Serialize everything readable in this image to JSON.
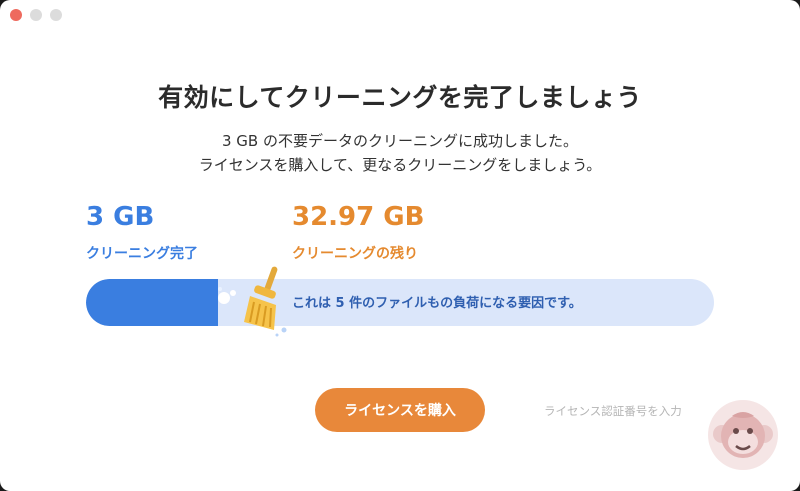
{
  "window": {
    "controls": [
      "close",
      "minimize",
      "maximize"
    ]
  },
  "header": {
    "title": "有効にしてクリーニングを完了しましょう",
    "subtitle_line1": "3 GB の不要データのクリーニングに成功しました。",
    "subtitle_line2": "ライセンスを購入して、更なるクリーニングをしましょう。"
  },
  "stats": {
    "cleaned": {
      "value": "3 GB",
      "label": "クリーニング完了",
      "color": "#3a7ee0"
    },
    "remaining": {
      "value": "32.97 GB",
      "label": "クリーニングの残り",
      "color": "#e58a2f"
    }
  },
  "progress": {
    "fraction": 0.21,
    "text": "これは 5 件のファイルもの負荷になる要因です。",
    "fill_color": "#3a7ee0",
    "track_color": "#dbe6fa",
    "icon": "broom-icon"
  },
  "actions": {
    "buy_label": "ライセンスを購入",
    "enter_license_label": "ライセンス認証番号を入力"
  },
  "watermark": {
    "icon": "monkey-logo-icon"
  }
}
